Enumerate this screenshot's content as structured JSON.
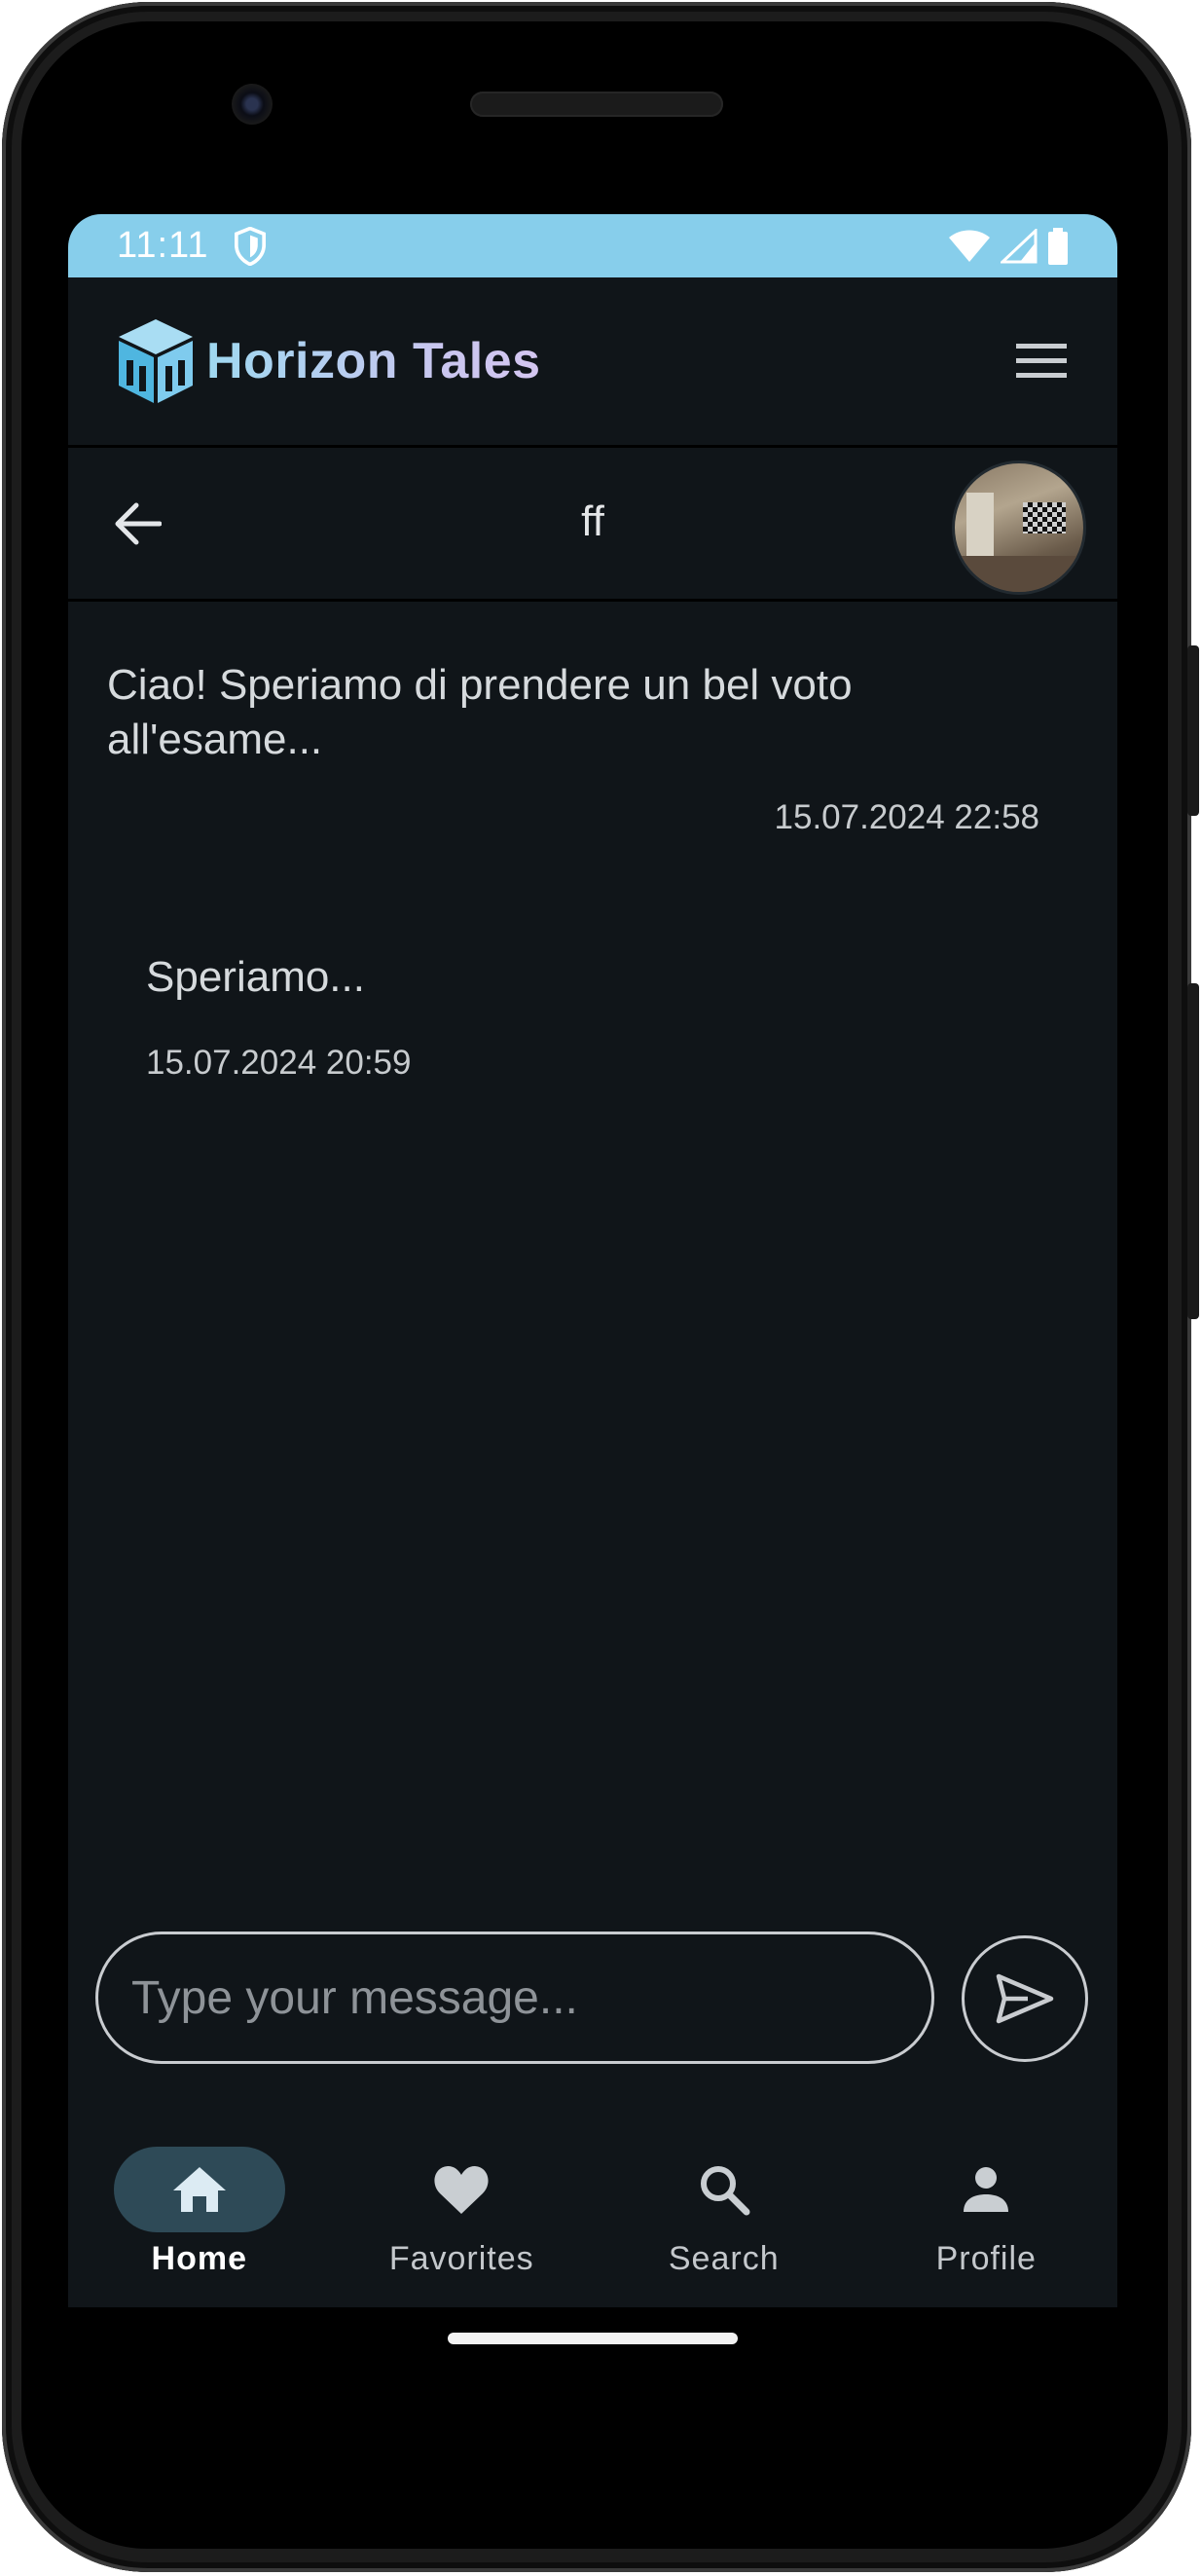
{
  "status_bar": {
    "time": "11:11",
    "background_color": "#87ceeb"
  },
  "app_header": {
    "title": "Horizon Tales",
    "logo_icon": "cube-logo-icon",
    "menu_icon": "hamburger-menu-icon"
  },
  "chat_header": {
    "back_icon": "arrow-left-icon",
    "contact_name": "ff",
    "avatar_alt": "contact avatar"
  },
  "messages": [
    {
      "text": "Ciao! Speriamo di prendere un bel voto all'esame...",
      "time": "15.07.2024 22:58"
    },
    {
      "text": "Speriamo...",
      "time": "15.07.2024 20:59"
    }
  ],
  "composer": {
    "placeholder": "Type your message...",
    "value": "",
    "send_icon": "send-icon"
  },
  "bottom_nav": {
    "items": [
      {
        "label": "Home",
        "icon": "home-icon",
        "active": true
      },
      {
        "label": "Favorites",
        "icon": "heart-icon",
        "active": false
      },
      {
        "label": "Search",
        "icon": "search-icon",
        "active": false
      },
      {
        "label": "Profile",
        "icon": "person-icon",
        "active": false
      }
    ],
    "active_color": "#2e4a57"
  }
}
